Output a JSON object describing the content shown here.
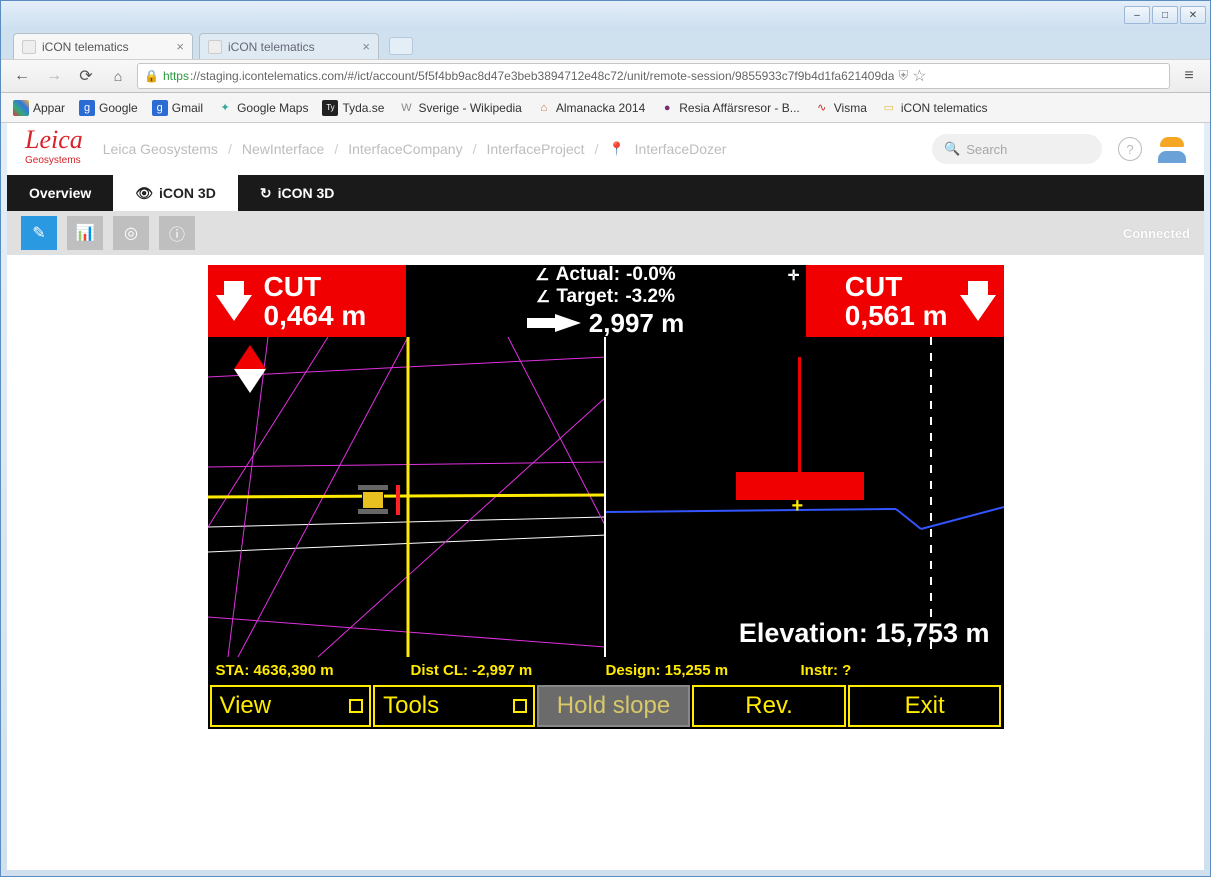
{
  "browser": {
    "tabs": [
      {
        "title": "iCON telematics",
        "active": true
      },
      {
        "title": "iCON telematics",
        "active": false
      }
    ],
    "url_https": "https",
    "url_rest": "://staging.icontelematics.com/#/ict/account/5f5f4bb9ac8d47e3beb3894712e48c72/unit/remote-session/9855933c7f9b4d1fa621409da",
    "bookmarks": [
      {
        "label": "Appar",
        "color": "#3b7"
      },
      {
        "label": "Google",
        "color": "#2a6bd4",
        "badge": "g"
      },
      {
        "label": "Gmail",
        "color": "#2a6bd4",
        "badge": "g"
      },
      {
        "label": "Google Maps",
        "color": "#3a9",
        "badge": "✦"
      },
      {
        "label": "Tyda.se",
        "color": "#333",
        "badge": "Ty"
      },
      {
        "label": "Sverige - Wikipedia",
        "color": "#888",
        "badge": "W"
      },
      {
        "label": "Almanacka 2014",
        "color": "#c63",
        "badge": "⌂"
      },
      {
        "label": "Resia Affärsresor - B...",
        "color": "#7a2d6e",
        "badge": "●"
      },
      {
        "label": "Visma",
        "color": "#c22",
        "badge": "∿"
      },
      {
        "label": "iCON telematics",
        "color": "#e8b94a",
        "badge": "▭"
      }
    ]
  },
  "header": {
    "logo_top": "Leica",
    "logo_bottom": "Geosystems",
    "breadcrumbs": [
      "Leica Geosystems",
      "NewInterface",
      "InterfaceCompany",
      "InterfaceProject",
      "InterfaceDozer"
    ],
    "search_placeholder": "Search"
  },
  "subtabs": {
    "overview": "Overview",
    "icon3d_view": "iCON 3D",
    "icon3d_sync": "iCON 3D"
  },
  "actionbar": {
    "connected": "Connected"
  },
  "icon3d": {
    "cut_left_label": "CUT",
    "cut_left_value": "0,464 m",
    "cut_right_label": "CUT",
    "cut_right_value": "0,561 m",
    "actual_label": "Actual:",
    "actual_value": "-0.0%",
    "target_label": "Target:",
    "target_value": "-3.2%",
    "distance": "2,997 m",
    "elevation_label": "Elevation:",
    "elevation_value": "15,753 m",
    "status": {
      "sta": "STA: 4636,390 m",
      "distcl": "Dist CL: -2,997 m",
      "design": "Design: 15,255 m",
      "instr": "Instr: ?"
    },
    "buttons": {
      "view": "View",
      "tools": "Tools",
      "hold": "Hold slope",
      "rev": "Rev.",
      "exit": "Exit"
    }
  }
}
